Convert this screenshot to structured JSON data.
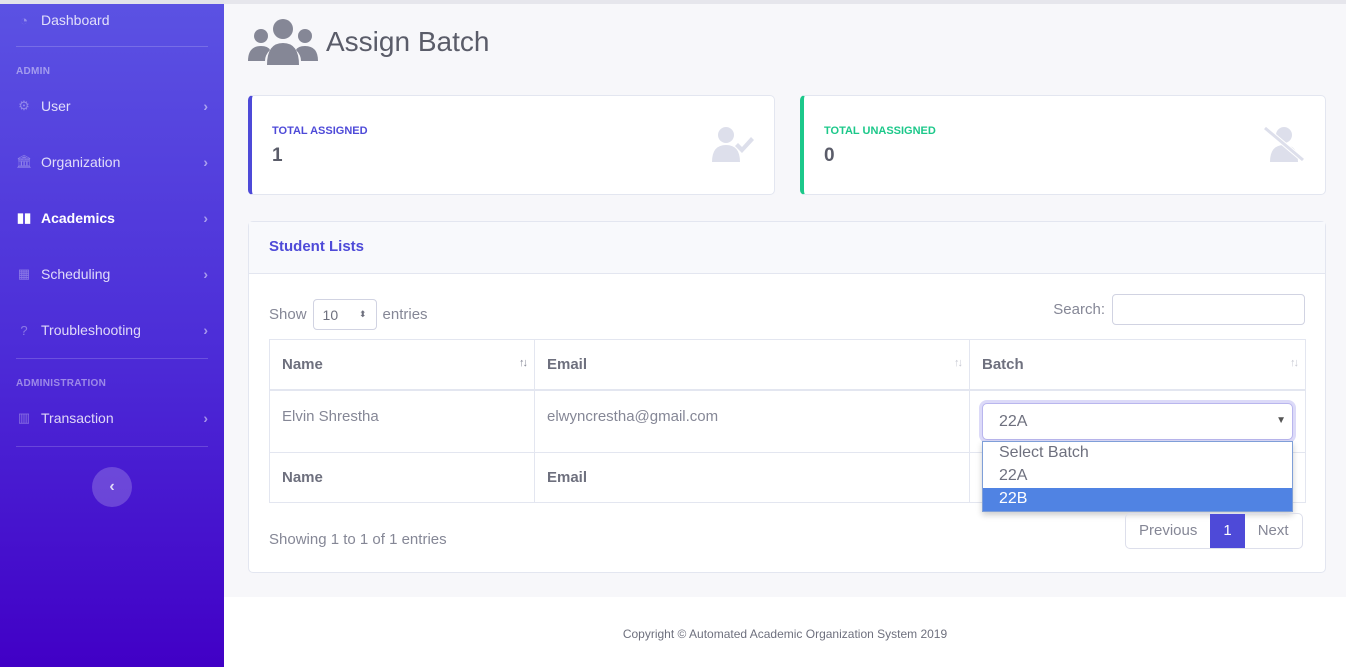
{
  "sidebar": {
    "dashboard": "Dashboard",
    "section_admin": "ADMIN",
    "items": [
      {
        "label": "User"
      },
      {
        "label": "Organization"
      },
      {
        "label": "Academics"
      },
      {
        "label": "Scheduling"
      },
      {
        "label": "Troubleshooting"
      }
    ],
    "section_administration": "ADMINISTRATION",
    "transaction": "Transaction"
  },
  "page": {
    "title": "Assign Batch"
  },
  "cards": [
    {
      "label": "TOTAL ASSIGNED",
      "value": "1",
      "color": "#4e4ad8"
    },
    {
      "label": "TOTAL UNASSIGNED",
      "value": "0",
      "color": "#1cc88a"
    }
  ],
  "panel": {
    "title": "Student Lists",
    "show": "Show",
    "entries_value": "10",
    "entries": "entries",
    "search_label": "Search:",
    "search_value": "",
    "columns": [
      "Name",
      "Email",
      "Batch"
    ],
    "rows": [
      {
        "name": "Elvin Shrestha",
        "email": "elwyncrestha@gmail.com",
        "batch": "22A"
      }
    ],
    "batch_options": [
      "Select Batch",
      "22A",
      "22B"
    ],
    "info": "Showing 1 to 1 of 1 entries",
    "prev": "Previous",
    "page": "1",
    "next": "Next"
  },
  "footer": "Copyright © Automated Academic Organization System 2019"
}
